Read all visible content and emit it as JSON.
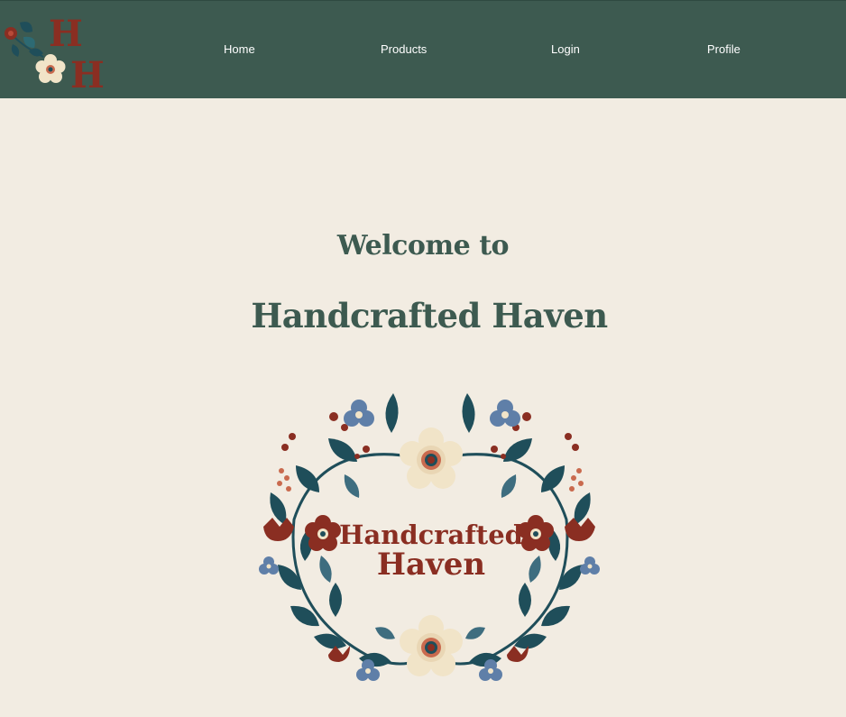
{
  "nav": {
    "logo_letters": [
      "H",
      "H"
    ],
    "links": [
      "Home",
      "Products",
      "Login",
      "Profile"
    ]
  },
  "hero": {
    "welcome": "Welcome to",
    "brand": "Handcrafted Haven"
  },
  "emblem": {
    "line1": "Handcrafted",
    "line2": "Haven"
  },
  "colors": {
    "header_bg": "#3d5a50",
    "page_bg": "#f2ece2",
    "heading": "#3d5a50",
    "accent_red": "#8a2e22",
    "leaf_dark": "#1f4e5a",
    "flower_blue": "#5f7fa8",
    "flower_cream": "#f1e4c8",
    "terracotta": "#c96a4e"
  },
  "icons": [
    "floral-logo-icon",
    "floral-wreath-icon"
  ]
}
